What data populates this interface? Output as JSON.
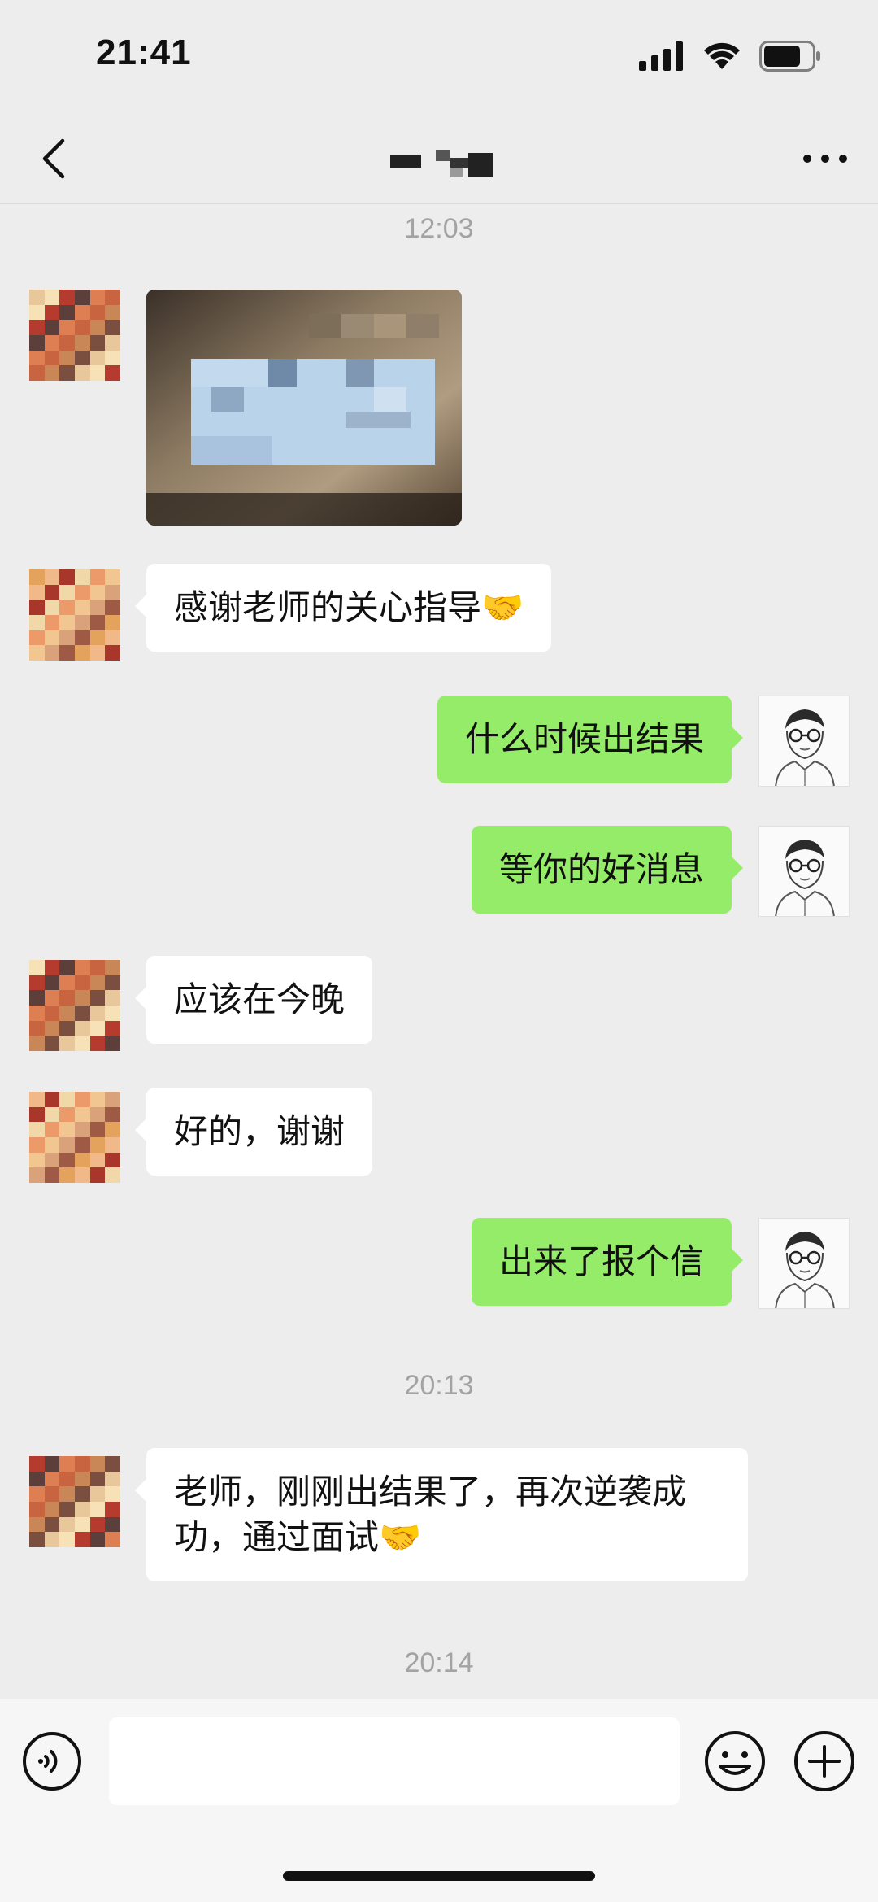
{
  "status_bar": {
    "time": "21:41",
    "battery_level": 0.75
  },
  "header": {
    "title_redacted": true,
    "back_icon": "chevron-left-icon",
    "more_icon": "more-dots-icon"
  },
  "timestamps": [
    "12:03",
    "20:13",
    "20:14"
  ],
  "messages": [
    {
      "side": "in",
      "type": "image"
    },
    {
      "side": "in",
      "type": "text",
      "text": "感谢老师的关心指导🤝"
    },
    {
      "side": "out",
      "type": "text",
      "text": "什么时候出结果"
    },
    {
      "side": "out",
      "type": "text",
      "text": "等你的好消息"
    },
    {
      "side": "in",
      "type": "text",
      "text": "应该在今晚"
    },
    {
      "side": "in",
      "type": "text",
      "text": "好的，谢谢"
    },
    {
      "side": "out",
      "type": "text",
      "text": "出来了报个信"
    },
    {
      "side": "in",
      "type": "text",
      "text": "老师，刚刚出结果了，再次逆袭成功，通过面试🤝"
    }
  ],
  "input_bar": {
    "voice_icon": "voice-icon",
    "input_value": "",
    "emoji_icon": "emoji-icon",
    "plus_icon": "plus-circle-icon"
  },
  "colors": {
    "background": "#ededed",
    "outgoing_bubble": "#95ec69",
    "incoming_bubble": "#ffffff",
    "timestamp": "#a3a3a3"
  }
}
